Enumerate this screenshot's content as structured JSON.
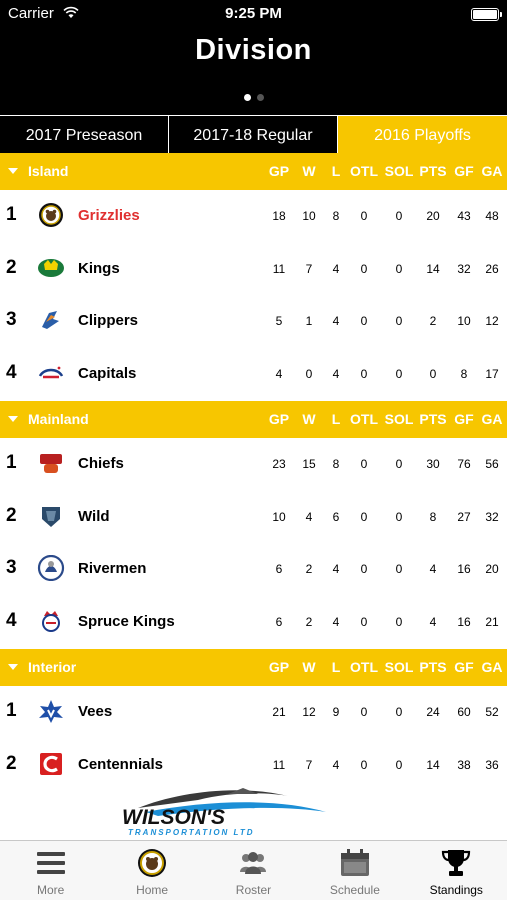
{
  "status_bar": {
    "carrier": "Carrier",
    "time": "9:25 PM"
  },
  "header": {
    "title": "Division",
    "page_dots": 2,
    "active_dot": 0
  },
  "segments": [
    {
      "label": "2017 Preseason",
      "selected": false
    },
    {
      "label": "2017-18 Regular",
      "selected": false
    },
    {
      "label": "2016 Playoffs",
      "selected": true
    }
  ],
  "columns": [
    "GP",
    "W",
    "L",
    "OTL",
    "SOL",
    "PTS",
    "GF",
    "GA"
  ],
  "colors": {
    "accent": "#f7c600",
    "header_bg": "#000000",
    "highlight_team": "#e03030"
  },
  "divisions": [
    {
      "name": "Island",
      "teams": [
        {
          "rank": "1",
          "name": "Grizzlies",
          "logo": "grizzlies-logo",
          "highlight": true,
          "stats": [
            "18",
            "10",
            "8",
            "0",
            "0",
            "20",
            "43",
            "48"
          ]
        },
        {
          "rank": "2",
          "name": "Kings",
          "logo": "kings-logo",
          "stats": [
            "11",
            "7",
            "4",
            "0",
            "0",
            "14",
            "32",
            "26"
          ]
        },
        {
          "rank": "3",
          "name": "Clippers",
          "logo": "clippers-logo",
          "stats": [
            "5",
            "1",
            "4",
            "0",
            "0",
            "2",
            "10",
            "12"
          ]
        },
        {
          "rank": "4",
          "name": "Capitals",
          "logo": "capitals-logo",
          "stats": [
            "4",
            "0",
            "4",
            "0",
            "0",
            "0",
            "8",
            "17"
          ]
        }
      ]
    },
    {
      "name": "Mainland",
      "teams": [
        {
          "rank": "1",
          "name": "Chiefs",
          "logo": "chiefs-logo",
          "stats": [
            "23",
            "15",
            "8",
            "0",
            "0",
            "30",
            "76",
            "56"
          ]
        },
        {
          "rank": "2",
          "name": "Wild",
          "logo": "wild-logo",
          "stats": [
            "10",
            "4",
            "6",
            "0",
            "0",
            "8",
            "27",
            "32"
          ]
        },
        {
          "rank": "3",
          "name": "Rivermen",
          "logo": "rivermen-logo",
          "stats": [
            "6",
            "2",
            "4",
            "0",
            "0",
            "4",
            "16",
            "20"
          ]
        },
        {
          "rank": "4",
          "name": "Spruce Kings",
          "logo": "spruce-kings-logo",
          "stats": [
            "6",
            "2",
            "4",
            "0",
            "0",
            "4",
            "16",
            "21"
          ]
        }
      ]
    },
    {
      "name": "Interior",
      "teams": [
        {
          "rank": "1",
          "name": "Vees",
          "logo": "vees-logo",
          "stats": [
            "21",
            "12",
            "9",
            "0",
            "0",
            "24",
            "60",
            "52"
          ]
        },
        {
          "rank": "2",
          "name": "Centennials",
          "logo": "centennials-logo",
          "stats": [
            "11",
            "7",
            "4",
            "0",
            "0",
            "14",
            "38",
            "36"
          ]
        }
      ]
    }
  ],
  "sponsor": {
    "name": "WILSON'S",
    "tagline": "TRANSPORTATION LTD"
  },
  "tab_bar": [
    {
      "label": "More",
      "icon": "menu-icon",
      "active": false
    },
    {
      "label": "Home",
      "icon": "grizzlies-home-icon",
      "active": false
    },
    {
      "label": "Roster",
      "icon": "roster-icon",
      "active": false
    },
    {
      "label": "Schedule",
      "icon": "calendar-icon",
      "active": false
    },
    {
      "label": "Standings",
      "icon": "trophy-icon",
      "active": true
    }
  ]
}
